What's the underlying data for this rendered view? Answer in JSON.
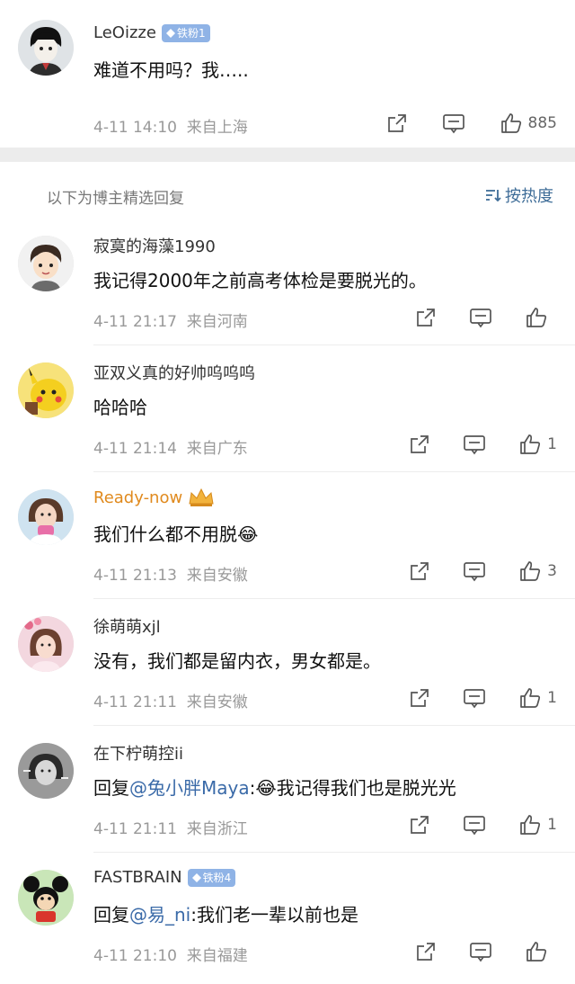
{
  "top_comment": {
    "username": "LeOizze",
    "badge": "铁粉1",
    "text": "难道不用吗？我…..",
    "time": "4-11 14:10",
    "location": "来自上海",
    "likes": "885"
  },
  "section": {
    "title": "以下为博主精选回复",
    "sort_label": "按热度"
  },
  "replies": [
    {
      "username": "寂寞的海藻1990",
      "text": "我记得2000年之前高考体检是要脱光的。",
      "time": "4-11 21:17",
      "location": "来自河南",
      "likes": ""
    },
    {
      "username": "亚双义真的好帅呜呜呜",
      "text": "哈哈哈",
      "time": "4-11 21:14",
      "location": "来自广东",
      "likes": "1"
    },
    {
      "username": "Ready-now",
      "text": "我们什么都不用脱😂",
      "time": "4-11 21:13",
      "location": "来自安徽",
      "likes": "3"
    },
    {
      "username": "徐萌萌xjl",
      "text": "没有，我们都是留内衣，男女都是。",
      "time": "4-11 21:11",
      "location": "来自安徽",
      "likes": "1"
    },
    {
      "username": "在下柠萌控ii",
      "reply_prefix": "回复",
      "mention": "@兔小胖Maya",
      "text": ":😂我记得我们也是脱光光",
      "time": "4-11 21:11",
      "location": "来自浙江",
      "likes": "1"
    },
    {
      "username": "FASTBRAIN",
      "badge": "铁粉4",
      "reply_prefix": "回复",
      "mention": "@易_ni",
      "text": ":我们老一辈以前也是",
      "time": "4-11 21:10",
      "location": "来自福建",
      "likes": ""
    }
  ],
  "colors": {
    "link": "#3a6aa8",
    "badge": "#8fb3e6",
    "vip_name": "#e08a1e",
    "meta": "#999999"
  }
}
